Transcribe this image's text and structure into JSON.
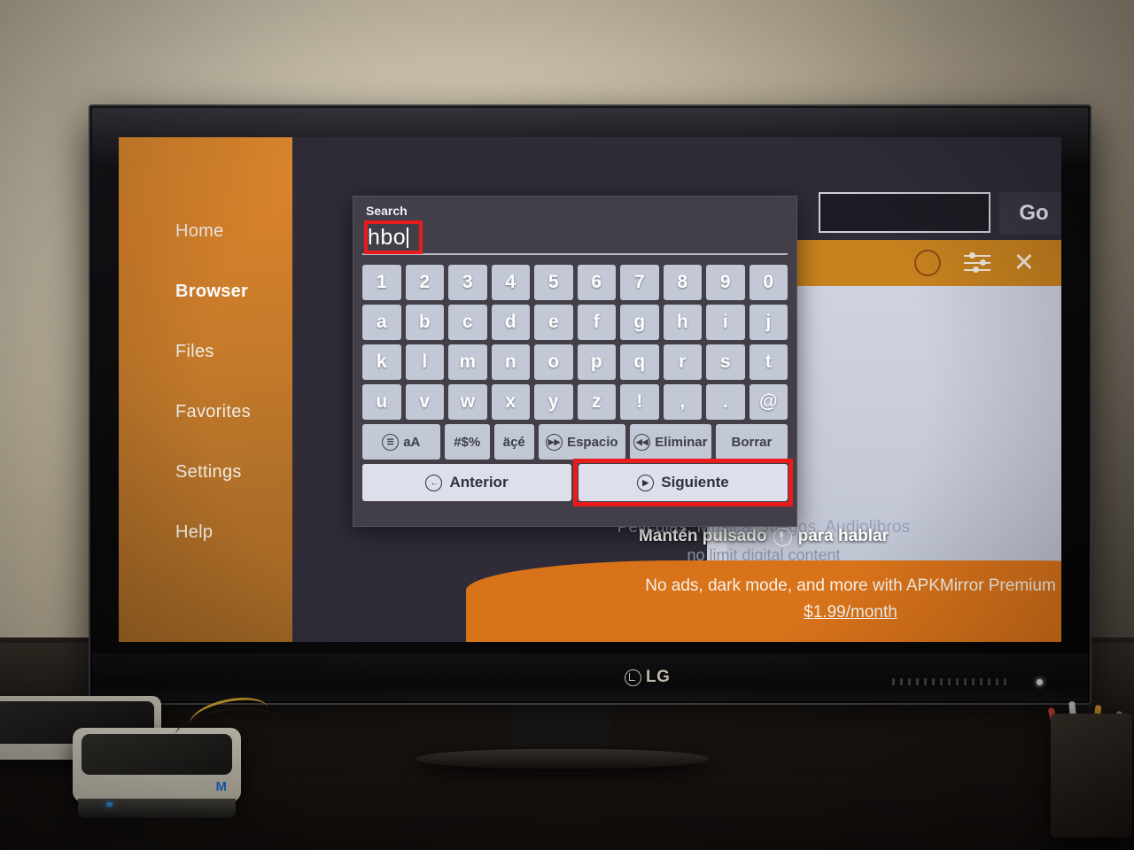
{
  "device": {
    "brand": "LG"
  },
  "sidebar": {
    "items": [
      {
        "label": "Home",
        "active": false
      },
      {
        "label": "Browser",
        "active": true
      },
      {
        "label": "Files",
        "active": false
      },
      {
        "label": "Favorites",
        "active": false
      },
      {
        "label": "Settings",
        "active": false
      },
      {
        "label": "Help",
        "active": false
      }
    ]
  },
  "browser_toolbar": {
    "url_value": "",
    "go_label": "Go",
    "menu_icon": "hamburger-icon"
  },
  "orange_toolbar": {
    "record_icon": "circle-icon",
    "settings_icon": "sliders-icon",
    "close_icon": "close-icon"
  },
  "page": {
    "close_icon": "close-icon",
    "tagline": "Películas, Música, Juegos, Audiolibros",
    "tagline2": "no limit digital content"
  },
  "voice_hint": {
    "prefix": "Mantén pulsado",
    "mic_icon": "microphone-icon",
    "suffix": "para hablar"
  },
  "premium_banner": {
    "line1": "No ads, dark mode, and more with APKMirror Premium",
    "line2": "$1.99/month",
    "close_icon": "close-icon"
  },
  "keyboard": {
    "title": "Search",
    "input_value": "hbo",
    "rows": [
      [
        "1",
        "2",
        "3",
        "4",
        "5",
        "6",
        "7",
        "8",
        "9",
        "0"
      ],
      [
        "a",
        "b",
        "c",
        "d",
        "e",
        "f",
        "g",
        "h",
        "i",
        "j"
      ],
      [
        "k",
        "l",
        "m",
        "n",
        "o",
        "p",
        "q",
        "r",
        "s",
        "t"
      ],
      [
        "u",
        "v",
        "w",
        "x",
        "y",
        "z",
        "!",
        ",",
        ".",
        "@"
      ]
    ],
    "function_row": [
      {
        "label": "aA",
        "icon": "menu-circle-icon",
        "key": "aA"
      },
      {
        "label": "#$%",
        "icon": "",
        "key": "sym"
      },
      {
        "label": "äçé",
        "icon": "",
        "key": "acc"
      },
      {
        "label": "Espacio",
        "icon": "play-forward-icon",
        "key": "space"
      },
      {
        "label": "Eliminar",
        "icon": "rewind-icon",
        "key": "del"
      },
      {
        "label": "Borrar",
        "icon": "",
        "key": "clear"
      }
    ],
    "nav_row": [
      {
        "label": "Anterior",
        "icon": "back-circle-icon",
        "highlighted": false
      },
      {
        "label": "Siguiente",
        "icon": "play-pause-icon",
        "highlighted": true
      }
    ]
  },
  "annotations": {
    "highlight_color": "#e81c1c",
    "targets": [
      "search-input",
      "siguiente-button"
    ]
  }
}
